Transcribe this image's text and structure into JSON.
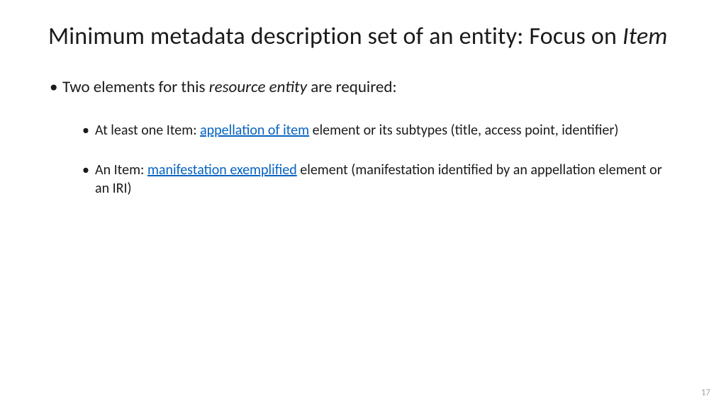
{
  "slide": {
    "title_part1": "Minimum metadata description set of an entity: Focus on ",
    "title_italic": "Item",
    "intro_part1": "Two elements for this ",
    "intro_italic": "resource entity",
    "intro_part2": " are required:",
    "bullet1_part1": "At least one Item: ",
    "bullet1_link": "appellation of item",
    "bullet1_part2": " element or its subtypes (title, access point, identifier)",
    "bullet2_part1": "An Item: ",
    "bullet2_link": "manifestation exemplified",
    "bullet2_part2": " element (manifestation identified by an appellation element or an IRI)",
    "page_number": "17"
  }
}
